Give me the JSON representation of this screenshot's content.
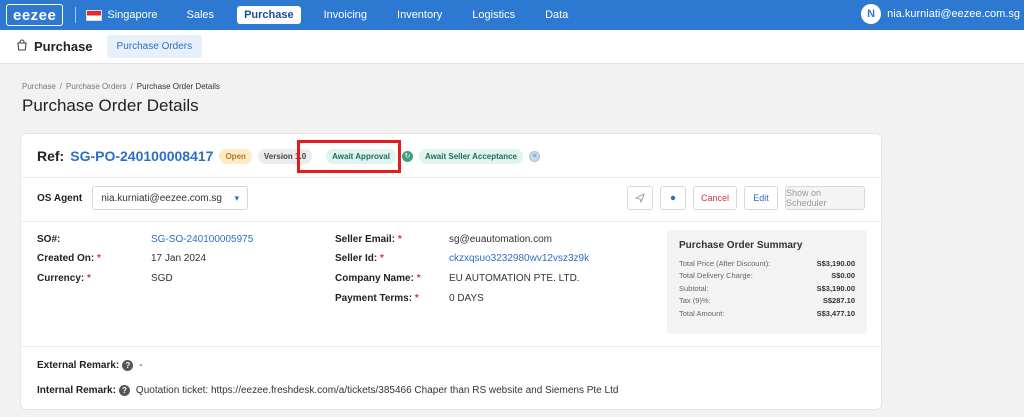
{
  "topnav": {
    "logo": "eezee",
    "country": "Singapore",
    "items": [
      {
        "label": "Sales",
        "active": false
      },
      {
        "label": "Purchase",
        "active": true
      },
      {
        "label": "Invoicing",
        "active": false
      },
      {
        "label": "Inventory",
        "active": false
      },
      {
        "label": "Logistics",
        "active": false
      },
      {
        "label": "Data",
        "active": false
      }
    ],
    "user_initial": "N",
    "user_email": "nia.kurniati@eezee.com.sg"
  },
  "subheader": {
    "title": "Purchase",
    "tab": "Purchase Orders"
  },
  "breadcrumb": [
    "Purchase",
    "Purchase Orders",
    "Purchase Order Details"
  ],
  "page_title": "Purchase Order Details",
  "order": {
    "ref_label": "Ref:",
    "ref_value": "SG-PO-240100008417",
    "status": "Open",
    "version": "Version 1.0",
    "step1": "Await Approval",
    "step2": "Await Seller Acceptance"
  },
  "agent": {
    "label": "OS Agent",
    "value": "nia.kurniati@eezee.com.sg"
  },
  "actions": {
    "cancel": "Cancel",
    "edit": "Edit",
    "scheduler": "Show on Scheduler"
  },
  "details_left": [
    {
      "label": "SO#:",
      "required": false,
      "value": "SG-SO-240100005975",
      "link": true
    },
    {
      "label": "Created On:",
      "required": true,
      "value": "17 Jan 2024",
      "link": false
    },
    {
      "label": "Currency:",
      "required": true,
      "value": "SGD",
      "link": false
    }
  ],
  "details_right": [
    {
      "label": "Seller Email:",
      "required": true,
      "value": "sg@euautomation.com",
      "link": false
    },
    {
      "label": "Seller Id:",
      "required": true,
      "value": "ckzxqsuo3232980wv12vsz3z9k",
      "link": true
    },
    {
      "label": "Company Name:",
      "required": true,
      "value": "EU AUTOMATION PTE. LTD.",
      "link": false
    },
    {
      "label": "Payment Terms:",
      "required": true,
      "value": "0 DAYS",
      "link": false
    }
  ],
  "summary": {
    "title": "Purchase Order Summary",
    "rows": [
      {
        "label": "Total Price (After Discount):",
        "value": "S$3,190.00"
      },
      {
        "label": "Total Delivery Charge:",
        "value": "S$0.00"
      },
      {
        "label": "Subtotal:",
        "value": "S$3,190.00"
      },
      {
        "label": "Tax (9)%:",
        "value": "S$287.10"
      },
      {
        "label": "Total Amount:",
        "value": "S$3,477.10"
      }
    ]
  },
  "remarks": {
    "external_label": "External Remark:",
    "external_value": "-",
    "internal_label": "Internal Remark:",
    "internal_value": "Quotation ticket: https://eezee.freshdesk.com/a/tickets/385466 Chaper than RS website and Siemens Pte Ltd"
  },
  "colors": {
    "nav_blue": "#2d78d0",
    "link_blue": "#2d6fc4",
    "highlight_red": "#e41c1c"
  }
}
